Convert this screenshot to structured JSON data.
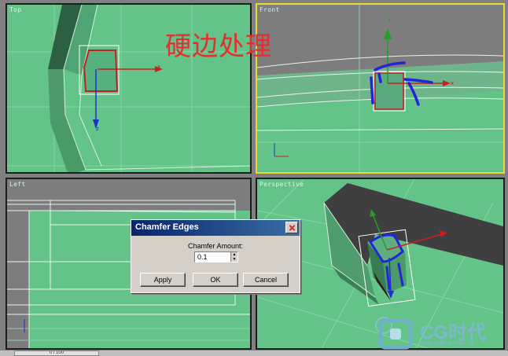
{
  "viewports": {
    "top": {
      "label": "Top"
    },
    "front": {
      "label": "Front"
    },
    "left": {
      "label": "Left"
    },
    "perspective": {
      "label": "Perspective"
    }
  },
  "annotation": "硬边处理",
  "axis_labels": {
    "x": "x",
    "y": "y",
    "z": "z"
  },
  "dialog": {
    "title": "Chamfer Edges",
    "field_label": "Chamfer Amount:",
    "field_value": "0.1",
    "apply_label": "Apply",
    "ok_label": "OK",
    "cancel_label": "Cancel"
  },
  "timeline": {
    "text": "0 / 100"
  },
  "logo": {
    "text": "CG时代",
    "url": "www.cgtime.com.cn"
  },
  "colors": {
    "viewport_bg": "#63c389",
    "active_border": "#e8d838",
    "annotation": "#e62c2c",
    "gizmo_x": "#cc2020",
    "gizmo_y": "#20a020",
    "gizmo_z": "#2030cc"
  }
}
